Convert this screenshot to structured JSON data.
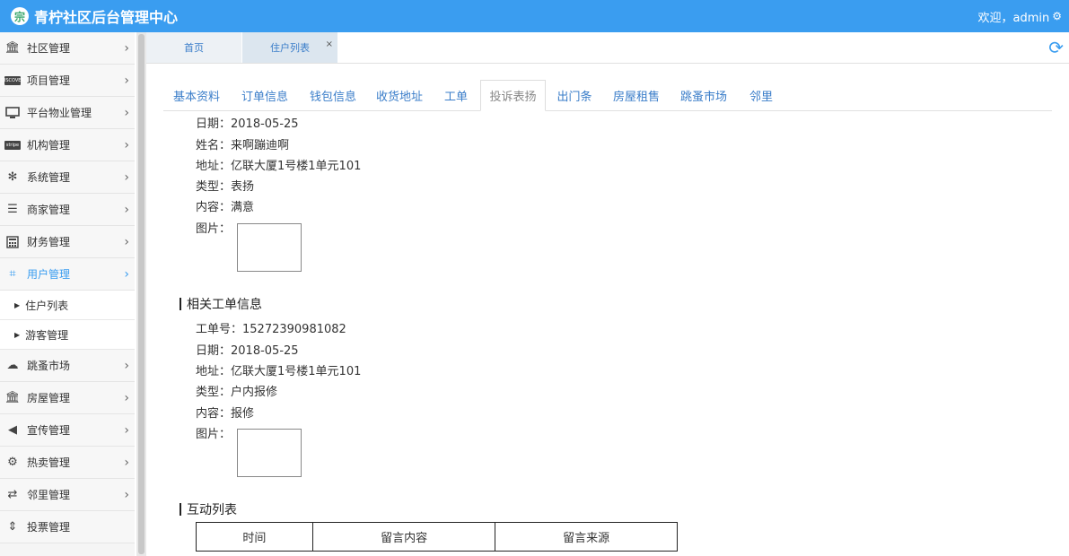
{
  "header": {
    "logo_glyph": "宗",
    "title": "青柠社区后台管理中心",
    "welcome": "欢迎，admin",
    "gear_glyph": "⚙"
  },
  "sidebar": {
    "items": [
      {
        "label": "社区管理",
        "icon": "bank-icon"
      },
      {
        "label": "项目管理",
        "icon": "card-icon"
      },
      {
        "label": "平台物业管理",
        "icon": "monitor-icon"
      },
      {
        "label": "机构管理",
        "icon": "stripe-icon"
      },
      {
        "label": "系统管理",
        "icon": "yelp-icon"
      },
      {
        "label": "商家管理",
        "icon": "menu-icon"
      },
      {
        "label": "财务管理",
        "icon": "calculator-icon"
      },
      {
        "label": "用户管理",
        "icon": "crop-icon",
        "active": true
      },
      {
        "label": "跳蚤市场",
        "icon": "cloud-icon"
      },
      {
        "label": "房屋管理",
        "icon": "bank-icon"
      },
      {
        "label": "宣传管理",
        "icon": "volume-icon"
      },
      {
        "label": "热卖管理",
        "icon": "gear-icon"
      },
      {
        "label": "邻里管理",
        "icon": "retweet-icon"
      },
      {
        "label": "投票管理",
        "icon": "sort-icon"
      }
    ],
    "sub_items": [
      "住户列表",
      "游客管理"
    ],
    "card_icon_text": "DISCOVER",
    "stripe_icon_text": "stripe"
  },
  "top_tabs": [
    {
      "label": "首页"
    },
    {
      "label": "住户列表",
      "closable": true
    }
  ],
  "close_glyph": "×",
  "refresh_glyph": "⟳",
  "sub_nav": [
    "基本资料",
    "订单信息",
    "钱包信息",
    "收货地址",
    "工单",
    "投诉表扬",
    "出门条",
    "房屋租售",
    "跳蚤市场",
    "邻里"
  ],
  "sub_nav_active": "投诉表扬",
  "complaint": {
    "date": "日期：2018-05-25",
    "name": "姓名：来啊蹦迪啊",
    "address": "地址：亿联大厦1号楼1单元101",
    "type": "类型：表扬",
    "content": "内容：满意",
    "image_label": "图片："
  },
  "work_order_section": {
    "title": "相关工单信息",
    "number": "工单号：15272390981082",
    "date": "日期：2018-05-25",
    "address": "地址：亿联大厦1号楼1单元101",
    "type": "类型：户内报修",
    "content": "内容：报修",
    "image_label": "图片："
  },
  "interaction": {
    "title": "互动列表",
    "columns": [
      "时间",
      "留言内容",
      "留言来源"
    ]
  }
}
